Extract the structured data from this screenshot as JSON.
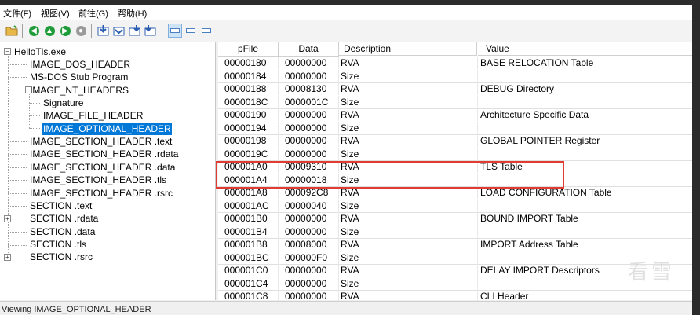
{
  "menu": [
    "文件(F)",
    "视图(V)",
    "前往(G)",
    "帮助(H)"
  ],
  "tree": {
    "items": [
      {
        "label": "HelloTls.exe"
      },
      {
        "label": "IMAGE_DOS_HEADER"
      },
      {
        "label": "MS-DOS Stub Program"
      },
      {
        "label": "IMAGE_NT_HEADERS"
      },
      {
        "label": "Signature"
      },
      {
        "label": "IMAGE_FILE_HEADER"
      },
      {
        "label": "IMAGE_OPTIONAL_HEADER"
      },
      {
        "label": "IMAGE_SECTION_HEADER .text"
      },
      {
        "label": "IMAGE_SECTION_HEADER .rdata"
      },
      {
        "label": "IMAGE_SECTION_HEADER .data"
      },
      {
        "label": "IMAGE_SECTION_HEADER .tls"
      },
      {
        "label": "IMAGE_SECTION_HEADER .rsrc"
      },
      {
        "label": "SECTION .text"
      },
      {
        "label": "SECTION .rdata"
      },
      {
        "label": "SECTION .data"
      },
      {
        "label": "SECTION .tls"
      },
      {
        "label": "SECTION .rsrc"
      }
    ],
    "selected": "IMAGE_OPTIONAL_HEADER"
  },
  "table": {
    "columns": [
      "pFile",
      "Data",
      "Description",
      "Value"
    ],
    "rows": [
      [
        "00000180",
        "00000000",
        "RVA",
        "BASE RELOCATION Table"
      ],
      [
        "00000184",
        "00000000",
        "Size",
        ""
      ],
      [
        "00000188",
        "00008130",
        "RVA",
        "DEBUG Directory"
      ],
      [
        "0000018C",
        "0000001C",
        "Size",
        ""
      ],
      [
        "00000190",
        "00000000",
        "RVA",
        "Architecture Specific Data"
      ],
      [
        "00000194",
        "00000000",
        "Size",
        ""
      ],
      [
        "00000198",
        "00000000",
        "RVA",
        "GLOBAL POINTER Register"
      ],
      [
        "0000019C",
        "00000000",
        "Size",
        ""
      ],
      [
        "000001A0",
        "00009310",
        "RVA",
        "TLS Table"
      ],
      [
        "000001A4",
        "00000018",
        "Size",
        ""
      ],
      [
        "000001A8",
        "000092C8",
        "RVA",
        "LOAD CONFIGURATION Table"
      ],
      [
        "000001AC",
        "00000040",
        "Size",
        ""
      ],
      [
        "000001B0",
        "00000000",
        "RVA",
        "BOUND IMPORT Table"
      ],
      [
        "000001B4",
        "00000000",
        "Size",
        ""
      ],
      [
        "000001B8",
        "00008000",
        "RVA",
        "IMPORT Address Table"
      ],
      [
        "000001BC",
        "000000F0",
        "Size",
        ""
      ],
      [
        "000001C0",
        "00000000",
        "RVA",
        "DELAY IMPORT Descriptors"
      ],
      [
        "000001C4",
        "00000000",
        "Size",
        ""
      ],
      [
        "000001C8",
        "00000000",
        "RVA",
        "CLI Header"
      ]
    ]
  },
  "status": "Viewing IMAGE_OPTIONAL_HEADER",
  "watermark": "看雪",
  "colors": {
    "selection": "#0078d7",
    "highlight": "#e03c31"
  }
}
